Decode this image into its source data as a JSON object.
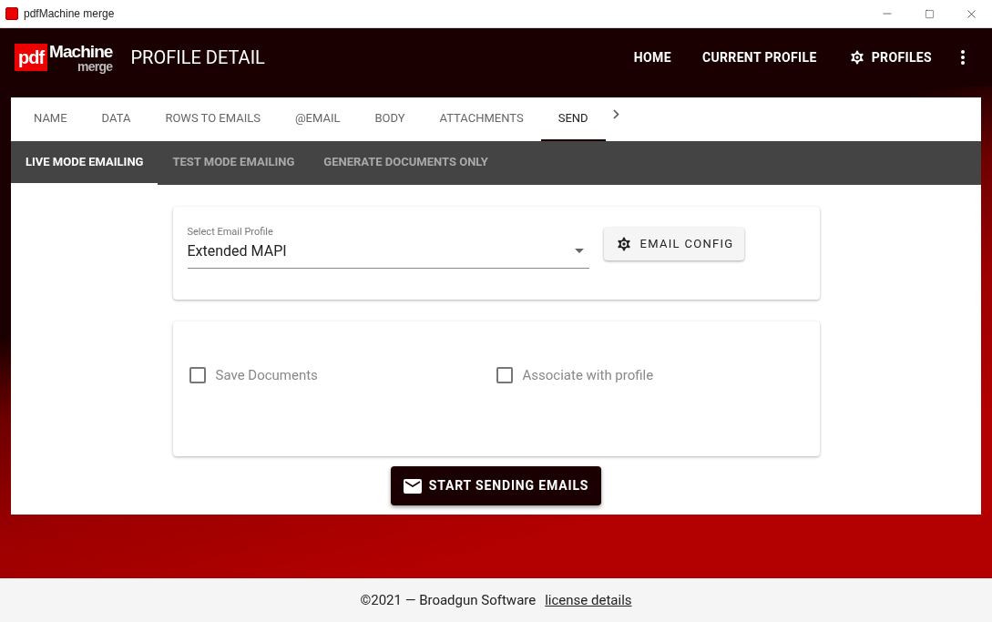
{
  "window": {
    "title": "pdfMachine merge"
  },
  "logo": {
    "part_1": "pdf",
    "part_2": "Machine",
    "part_3": "merge"
  },
  "header": {
    "title": "PROFILE DETAIL",
    "nav": [
      "HOME",
      "CURRENT PROFILE",
      "PROFILES"
    ]
  },
  "tabs": [
    {
      "label": "NAME",
      "selected": false
    },
    {
      "label": "DATA",
      "selected": false
    },
    {
      "label": "ROWS TO EMAILS",
      "selected": false
    },
    {
      "label": "@EMAIL",
      "selected": false
    },
    {
      "label": "BODY",
      "selected": false
    },
    {
      "label": "ATTACHMENTS",
      "selected": false
    },
    {
      "label": "SEND",
      "selected": true
    }
  ],
  "mode_tabs": [
    {
      "label": "LIVE MODE EMAILING",
      "selected": true
    },
    {
      "label": "TEST MODE EMAILING",
      "selected": false
    },
    {
      "label": "GENERATE DOCUMENTS ONLY",
      "selected": false
    }
  ],
  "email_profile": {
    "label": "Select Email Profile",
    "value": "Extended MAPI"
  },
  "email_config_button": "EMAIL CONFIG",
  "options": [
    {
      "label": "Save Documents",
      "checked": false,
      "disabled": true
    },
    {
      "label": "Associate with profile",
      "checked": false,
      "disabled": true
    }
  ],
  "send_button": "START SENDING EMAILS",
  "footer": {
    "text": "©2021 — Broadgun Software",
    "link": "license details"
  }
}
